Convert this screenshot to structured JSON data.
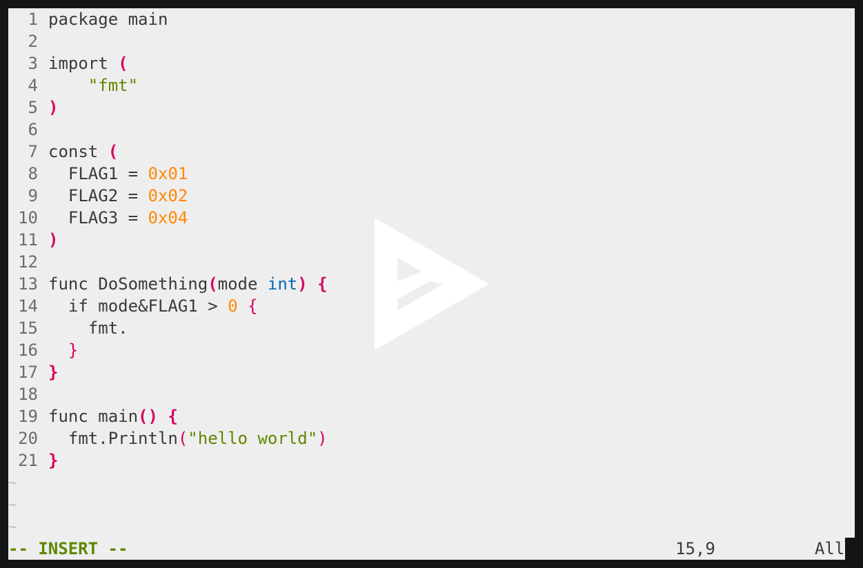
{
  "editor": {
    "lines": [
      {
        "num": "1",
        "tokens": [
          {
            "t": "package main",
            "c": "plain"
          }
        ]
      },
      {
        "num": "2",
        "tokens": []
      },
      {
        "num": "3",
        "tokens": [
          {
            "t": "import ",
            "c": "plain"
          },
          {
            "t": "(",
            "c": "paren"
          }
        ]
      },
      {
        "num": "4",
        "tokens": [
          {
            "t": "    ",
            "c": "plain"
          },
          {
            "t": "\"fmt\"",
            "c": "str"
          }
        ]
      },
      {
        "num": "5",
        "tokens": [
          {
            "t": ")",
            "c": "paren"
          }
        ]
      },
      {
        "num": "6",
        "tokens": []
      },
      {
        "num": "7",
        "tokens": [
          {
            "t": "const ",
            "c": "plain"
          },
          {
            "t": "(",
            "c": "paren"
          }
        ]
      },
      {
        "num": "8",
        "tokens": [
          {
            "t": "  FLAG1 = ",
            "c": "plain"
          },
          {
            "t": "0x01",
            "c": "num"
          }
        ]
      },
      {
        "num": "9",
        "tokens": [
          {
            "t": "  FLAG2 = ",
            "c": "plain"
          },
          {
            "t": "0x02",
            "c": "num"
          }
        ]
      },
      {
        "num": "10",
        "tokens": [
          {
            "t": "  FLAG3 = ",
            "c": "plain"
          },
          {
            "t": "0x04",
            "c": "num"
          }
        ]
      },
      {
        "num": "11",
        "tokens": [
          {
            "t": ")",
            "c": "paren"
          }
        ]
      },
      {
        "num": "12",
        "tokens": []
      },
      {
        "num": "13",
        "tokens": [
          {
            "t": "func DoSomething",
            "c": "plain"
          },
          {
            "t": "(",
            "c": "paren"
          },
          {
            "t": "mode ",
            "c": "plain"
          },
          {
            "t": "int",
            "c": "type"
          },
          {
            "t": ")",
            "c": "paren"
          },
          {
            "t": " ",
            "c": "plain"
          },
          {
            "t": "{",
            "c": "paren"
          }
        ]
      },
      {
        "num": "14",
        "tokens": [
          {
            "t": "  if mode&FLAG1 > ",
            "c": "plain"
          },
          {
            "t": "0",
            "c": "num"
          },
          {
            "t": " ",
            "c": "plain"
          },
          {
            "t": "{",
            "c": "paren-light"
          }
        ]
      },
      {
        "num": "15",
        "tokens": [
          {
            "t": "    fmt.",
            "c": "plain"
          }
        ]
      },
      {
        "num": "16",
        "tokens": [
          {
            "t": "  ",
            "c": "plain"
          },
          {
            "t": "}",
            "c": "paren-light"
          }
        ]
      },
      {
        "num": "17",
        "tokens": [
          {
            "t": "}",
            "c": "paren"
          }
        ]
      },
      {
        "num": "18",
        "tokens": []
      },
      {
        "num": "19",
        "tokens": [
          {
            "t": "func main",
            "c": "plain"
          },
          {
            "t": "()",
            "c": "paren"
          },
          {
            "t": " ",
            "c": "plain"
          },
          {
            "t": "{",
            "c": "paren"
          }
        ]
      },
      {
        "num": "20",
        "tokens": [
          {
            "t": "  fmt.Println",
            "c": "plain"
          },
          {
            "t": "(",
            "c": "paren-light"
          },
          {
            "t": "\"hello world\"",
            "c": "str"
          },
          {
            "t": ")",
            "c": "paren-light"
          }
        ]
      },
      {
        "num": "21",
        "tokens": [
          {
            "t": "}",
            "c": "paren"
          }
        ]
      }
    ],
    "tilde_lines": [
      "~",
      "~",
      "~"
    ]
  },
  "statusline": {
    "mode": "-- INSERT --",
    "cursor_position": "15,9",
    "scroll_position": "All"
  },
  "overlay": {
    "icon": "play-logo-icon",
    "color": "#ffffff"
  },
  "colors": {
    "background": "#eeeeee",
    "frame": "#141516",
    "string": "#5f8700",
    "number": "#ff8700",
    "paren": "#d7005f",
    "type": "#0069b4",
    "mode": "#5f8700"
  }
}
